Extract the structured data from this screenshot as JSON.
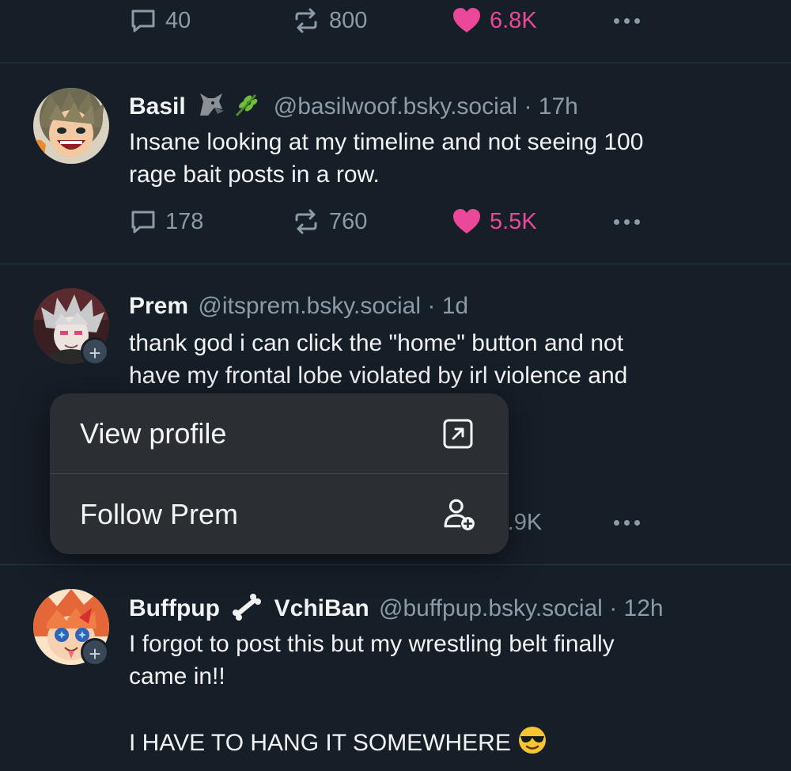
{
  "top_post": {
    "replies": "40",
    "reposts": "800",
    "likes": "6.8K"
  },
  "posts": [
    {
      "name": "Basil",
      "handle": "@basilwoof.bsky.social",
      "separator": "·",
      "time": "17h",
      "text_lines": [
        "Insane looking at my timeline and not seeing 100",
        "rage bait posts in a row."
      ],
      "replies": "178",
      "reposts": "760",
      "likes": "5.5K",
      "name_emojis": [
        "wolf-icon",
        "herb-icon"
      ]
    },
    {
      "name": "Prem",
      "handle": "@itsprem.bsky.social",
      "separator": "·",
      "time": "1d",
      "text_lines": [
        "thank god i can click the \"home\" button and not",
        "have my frontal lobe violated by irl violence and"
      ],
      "likes_partial": ").9K",
      "follow_badge": "+"
    },
    {
      "name": "Buffpup",
      "name_suffix": "VchiBan",
      "handle": "@buffpup.bsky.social",
      "separator": "·",
      "time": "12h",
      "text_lines": [
        "I forgot to post this but my wrestling belt finally",
        "came in!!",
        "",
        "I HAVE TO HANG IT SOMEWHERE"
      ],
      "follow_badge": "+",
      "name_emojis": [
        "bone-icon"
      ],
      "text_emojis": [
        "sunglasses-face-icon"
      ]
    }
  ],
  "context_menu": {
    "items": [
      {
        "label": "View profile",
        "icon": "external-link-icon"
      },
      {
        "label": "Follow Prem",
        "icon": "person-add-icon"
      }
    ]
  },
  "colors": {
    "background": "#161e27",
    "like_pink": "#ec4899",
    "muted_text": "#8d9aa8",
    "menu_background": "#2b2f34"
  }
}
